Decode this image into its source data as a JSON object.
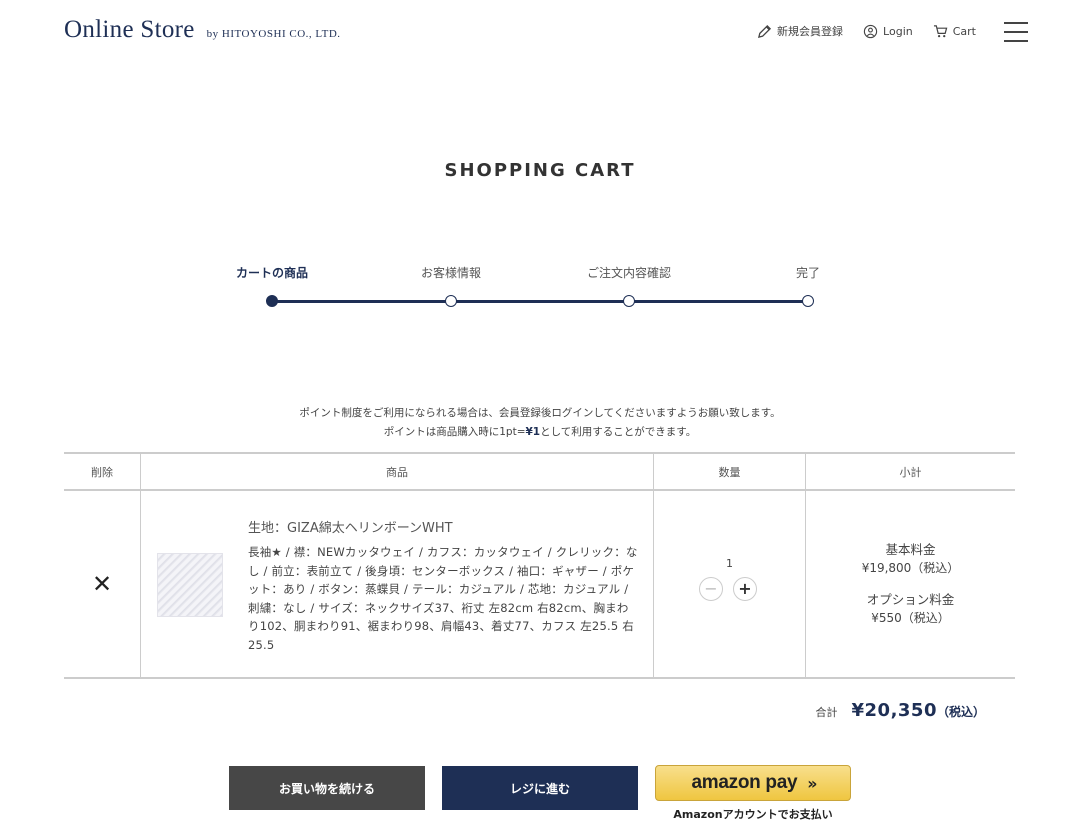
{
  "header": {
    "logo_main": "Online Store",
    "logo_sub": "by HITOYOSHI CO., LTD.",
    "nav": {
      "register": "新規会員登録",
      "login": "Login",
      "cart": "Cart"
    }
  },
  "page_title": "SHOPPING CART",
  "steps": [
    {
      "label": "カートの商品",
      "active": true
    },
    {
      "label": "お客様情報",
      "active": false
    },
    {
      "label": "ご注文内容確認",
      "active": false
    },
    {
      "label": "完了",
      "active": false
    }
  ],
  "notice": {
    "line1": "ポイント制度をご利用になられる場合は、会員登録後ログインしてくださいますようお願い致します。",
    "line2_pre": "ポイントは商品購入時に1pt=",
    "line2_bold": "¥1",
    "line2_post": "として利用することができます。"
  },
  "table": {
    "headers": {
      "delete": "削除",
      "product": "商品",
      "quantity": "数量",
      "subtotal": "小計"
    },
    "item": {
      "delete_symbol": "✕",
      "name": "生地：GIZA綿太ヘリンボーンWHT",
      "description": "長袖★ / 襟：NEWカッタウェイ / カフス：カッタウェイ / クレリック：なし / 前立：表前立て / 後身頃：センターボックス / 袖口：ギャザー / ポケット：あり / ボタン：蒸蝶貝 / テール：カジュアル / 芯地：カジュアル / 刺繍：なし / サイズ：ネックサイズ37、裄丈 左82cm 右82cm、胸まわり102、胴まわり91、裾まわり98、肩幅43、着丈77、カフス 左25.5 右25.5",
      "quantity": "1",
      "minus_symbol": "−",
      "plus_symbol": "+",
      "base_label": "基本料金",
      "base_price": "¥19,800（税込）",
      "option_label": "オプション料金",
      "option_price": "¥550（税込）"
    }
  },
  "total": {
    "label": "合計",
    "price": "¥20,350",
    "tax": "（税込）"
  },
  "buttons": {
    "continue": "お買い物を続ける",
    "checkout": "レジに進む",
    "amazon_pay": "amazon pay",
    "amazon_arrows": "››",
    "amazon_caption": "Amazonアカウントでお支払い"
  },
  "colors": {
    "navy": "#1e2f55",
    "dark_gray": "#474747",
    "amazon_yellow": "#efc640"
  }
}
